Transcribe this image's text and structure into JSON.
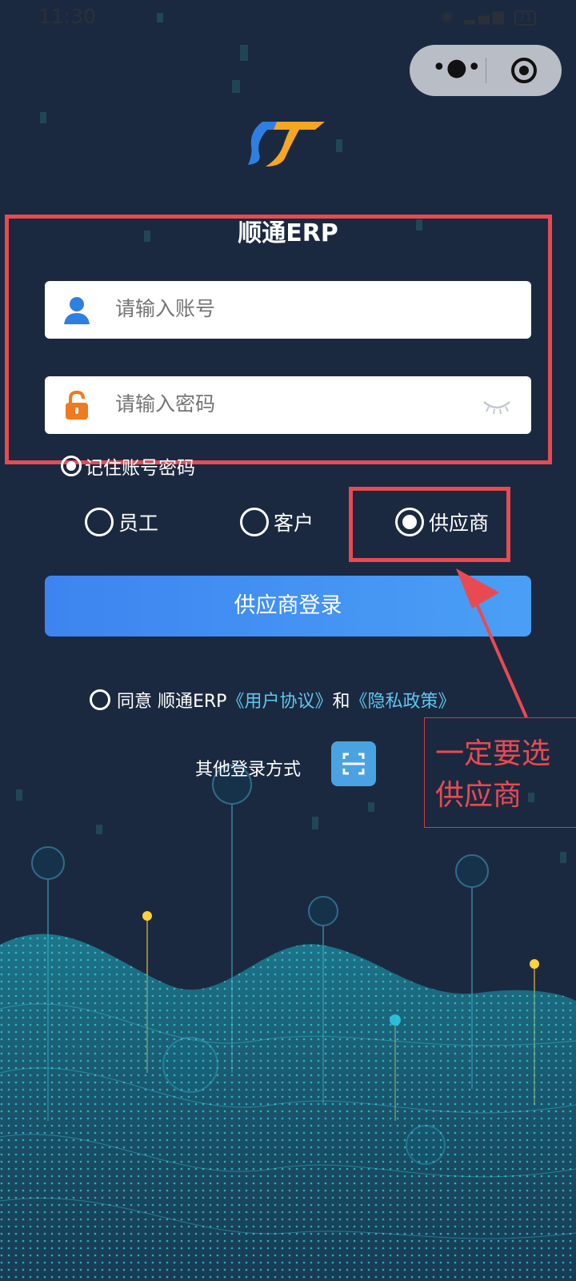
{
  "status_bar": {
    "time": "11:30",
    "battery": "71"
  },
  "app": {
    "title": "顺通ERP"
  },
  "account_field": {
    "placeholder": "请输入账号",
    "value": ""
  },
  "password_field": {
    "placeholder": "请输入密码",
    "value": ""
  },
  "remember": {
    "label": "记住账号密码"
  },
  "roles": [
    {
      "label": "员工",
      "selected": false
    },
    {
      "label": "客户",
      "selected": false
    },
    {
      "label": "供应商",
      "selected": true
    }
  ],
  "login_button": {
    "label": "供应商登录"
  },
  "agreement": {
    "prefix": "同意 顺通ERP",
    "user_agreement": "《用户协议》",
    "and": "和",
    "privacy": "《隐私政策》"
  },
  "other_login": {
    "label": "其他登录方式",
    "icon": "scan-icon"
  },
  "annotation": {
    "text": "一定要选供应商"
  },
  "colors": {
    "background": "#1b2940",
    "button": "#3d84f0",
    "link": "#5fc6f0",
    "annotation": "#e64b52"
  }
}
